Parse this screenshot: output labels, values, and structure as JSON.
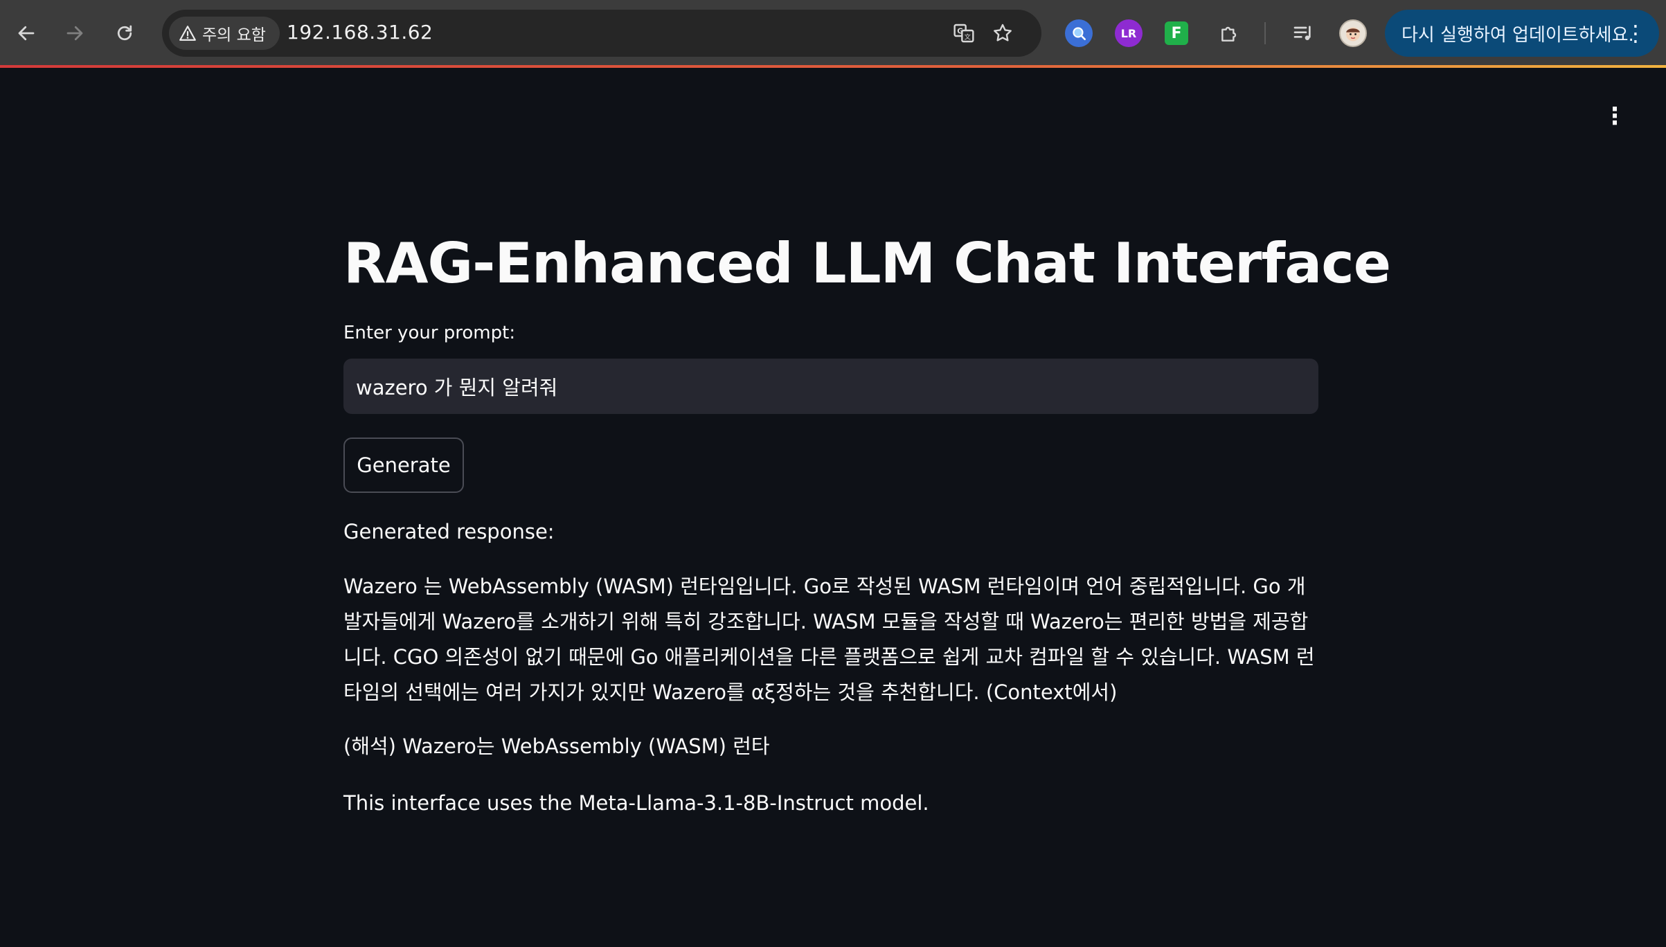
{
  "browser": {
    "security_label": "주의 요함",
    "url": "192.168.31.62",
    "update_button_label": "다시 실행하여 업데이트하세요.",
    "icons": {
      "back": "arrow-left-icon",
      "forward": "arrow-right-icon",
      "reload": "reload-icon",
      "warning": "warning-triangle-icon",
      "translate": "translate-icon",
      "bookmark": "star-icon",
      "extension_search": "search-extension-icon",
      "extension_lr": "lr-extension-icon",
      "extension_f": "f-extension-icon",
      "extensions_menu": "puzzle-icon",
      "reading_list": "media-playlist-icon",
      "profile": "avatar",
      "menu": "kebab-menu-icon"
    },
    "colors": {
      "toolbar": "#3c3c3c",
      "omnibox": "#262626",
      "update_pill": "#0b4a78",
      "progress_start": "#d33a3a",
      "progress_end": "#f1b33f"
    }
  },
  "app": {
    "title": "RAG-Enhanced LLM Chat Interface",
    "prompt": {
      "label": "Enter your prompt:",
      "value": "wazero 가 뭔지 알려줘"
    },
    "generate_button_label": "Generate",
    "response": {
      "label": "Generated response:",
      "body": "Wazero 는 WebAssembly (WASM) 런타임입니다. Go로 작성된 WASM 런타임이며 언어 중립적입니다. Go 개발자들에게 Wazero를 소개하기 위해 특히 강조합니다. WASM 모듈을 작성할 때 Wazero는 편리한 방법을 제공합니다. CGO 의존성이 없기 때문에 Go 애플리케이션을 다른 플랫폼으로 쉽게 교차 컴파일 할 수 있습니다. WASM 런타임의 선택에는 여러 가지가 있지만 Wazero를 αξ정하는 것을 추천합니다. (Context에서)",
      "translation": "(해석) Wazero는 WebAssembly (WASM) 런타"
    },
    "model_note": "This interface uses the Meta-Llama-3.1-8B-Instruct model.",
    "colors": {
      "background": "#0e1117",
      "input_background": "#262730",
      "text": "#fafafa",
      "button_border": "#4a4c55"
    }
  }
}
